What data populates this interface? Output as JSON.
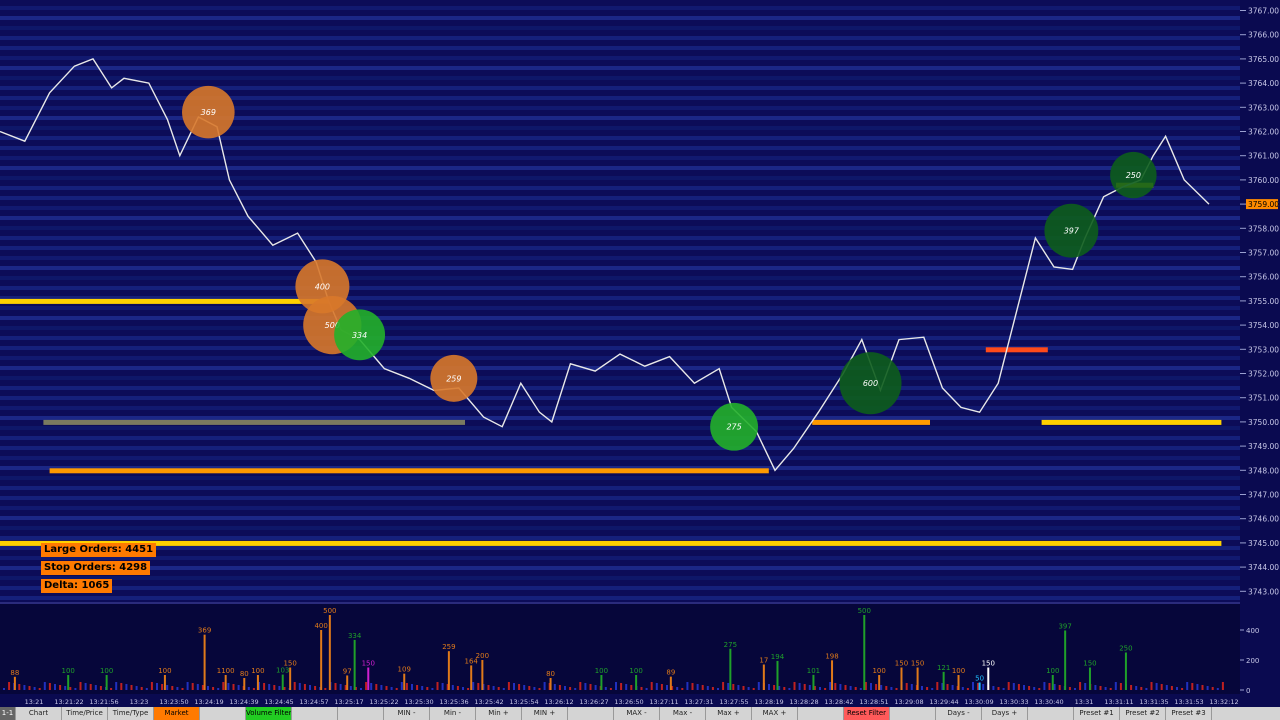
{
  "price_axis": {
    "labels": [
      "3767.00",
      "3766.00",
      "3765.00",
      "3764.00",
      "3763.00",
      "3762.00",
      "3761.00",
      "3760.00",
      "3759.00",
      "3758.00",
      "3757.00",
      "3756.00",
      "3755.00",
      "3754.00",
      "3753.00",
      "3752.00",
      "3751.00",
      "3750.00",
      "3749.00",
      "3748.00",
      "3747.00",
      "3746.00",
      "3745.00",
      "3744.00",
      "3743.00"
    ],
    "current_price": "3759.00"
  },
  "time_axis": {
    "labels": [
      "13:21",
      "13:21:22",
      "13:21:56",
      "13:23",
      "13:23:50",
      "13:24:19",
      "13:24:39",
      "13:24:45",
      "13:24:57",
      "13:25:17",
      "13:25:22",
      "13:25:30",
      "13:25:36",
      "13:25:42",
      "13:25:54",
      "13:26:12",
      "13:26:27",
      "13:26:50",
      "13:27:11",
      "13:27:31",
      "13:27:55",
      "13:28:19",
      "13:28:28",
      "13:28:42",
      "13:28:51",
      "13:29:08",
      "13:29:44",
      "13:30:09",
      "13:30:33",
      "13:30:40",
      "13:31",
      "13:31:11",
      "13:31:35",
      "13:31:53",
      "13:32:12"
    ]
  },
  "info": {
    "large_orders": "Large Orders: 4451",
    "stop_orders": "Stop Orders: 4298",
    "delta": "Delta: 1065"
  },
  "bubbles": [
    {
      "label": "369",
      "price": 3762.8,
      "t": 0.168,
      "color": "orange",
      "size": 369
    },
    {
      "label": "400",
      "price": 3755.6,
      "t": 0.26,
      "color": "orange",
      "size": 400
    },
    {
      "label": "500",
      "price": 3754.0,
      "t": 0.268,
      "color": "orange",
      "size": 500
    },
    {
      "label": "334",
      "price": 3753.6,
      "t": 0.29,
      "color": "green",
      "size": 334
    },
    {
      "label": "259",
      "price": 3751.8,
      "t": 0.366,
      "color": "orange",
      "size": 259
    },
    {
      "label": "275",
      "price": 3749.8,
      "t": 0.592,
      "color": "green",
      "size": 275
    },
    {
      "label": "600",
      "price": 3751.6,
      "t": 0.702,
      "color": "darkgreen",
      "size": 600
    },
    {
      "label": "397",
      "price": 3757.9,
      "t": 0.864,
      "color": "darkgreen",
      "size": 397
    },
    {
      "label": "250",
      "price": 3760.2,
      "t": 0.914,
      "color": "darkgreen",
      "size": 250
    }
  ],
  "liquidity_levels": [
    {
      "price": 3755.0,
      "from": 0.0,
      "to": 0.265,
      "intensity": "yellow"
    },
    {
      "price": 3750.0,
      "from": 0.035,
      "to": 0.375,
      "intensity": "faint"
    },
    {
      "price": 3748.0,
      "from": 0.04,
      "to": 0.62,
      "intensity": "orange"
    },
    {
      "price": 3745.0,
      "from": 0.0,
      "to": 0.985,
      "intensity": "yellow"
    },
    {
      "price": 3750.0,
      "from": 0.84,
      "to": 0.985,
      "intensity": "yellow"
    },
    {
      "price": 3750.0,
      "from": 0.655,
      "to": 0.75,
      "intensity": "orange"
    },
    {
      "price": 3753.0,
      "from": 0.795,
      "to": 0.845,
      "intensity": "red"
    },
    {
      "price": 3759.8,
      "from": 0.9,
      "to": 0.93,
      "intensity": "yellow"
    }
  ],
  "volume_axis": [
    "400",
    "200",
    "0"
  ],
  "volume_labels": [
    {
      "label": "88",
      "t": 0.012,
      "v": 88,
      "color": "orange"
    },
    {
      "label": "100",
      "t": 0.055,
      "v": 100,
      "color": "green"
    },
    {
      "label": "100",
      "t": 0.086,
      "v": 100,
      "color": "green"
    },
    {
      "label": "100",
      "t": 0.133,
      "v": 100,
      "color": "orange"
    },
    {
      "label": "369",
      "t": 0.165,
      "v": 369,
      "color": "orange"
    },
    {
      "label": "1100",
      "t": 0.182,
      "v": 100,
      "color": "orange"
    },
    {
      "label": "80",
      "t": 0.197,
      "v": 80,
      "color": "orange"
    },
    {
      "label": "100",
      "t": 0.208,
      "v": 100,
      "color": "orange"
    },
    {
      "label": "103",
      "t": 0.228,
      "v": 103,
      "color": "green"
    },
    {
      "label": "150",
      "t": 0.234,
      "v": 150,
      "color": "orange"
    },
    {
      "label": "400",
      "t": 0.259,
      "v": 400,
      "color": "orange"
    },
    {
      "label": "500",
      "t": 0.266,
      "v": 500,
      "color": "orange"
    },
    {
      "label": "334",
      "t": 0.286,
      "v": 334,
      "color": "green"
    },
    {
      "label": "97",
      "t": 0.28,
      "v": 97,
      "color": "orange"
    },
    {
      "label": "150",
      "t": 0.297,
      "v": 150,
      "color": "magenta"
    },
    {
      "label": "109",
      "t": 0.326,
      "v": 109,
      "color": "orange"
    },
    {
      "label": "259",
      "t": 0.362,
      "v": 259,
      "color": "orange"
    },
    {
      "label": "164",
      "t": 0.38,
      "v": 164,
      "color": "orange"
    },
    {
      "label": "200",
      "t": 0.389,
      "v": 200,
      "color": "orange"
    },
    {
      "label": "80",
      "t": 0.444,
      "v": 80,
      "color": "orange"
    },
    {
      "label": "100",
      "t": 0.485,
      "v": 100,
      "color": "green"
    },
    {
      "label": "100",
      "t": 0.513,
      "v": 100,
      "color": "green"
    },
    {
      "label": "89",
      "t": 0.541,
      "v": 89,
      "color": "orange"
    },
    {
      "label": "275",
      "t": 0.589,
      "v": 275,
      "color": "green"
    },
    {
      "label": "17",
      "t": 0.616,
      "v": 170,
      "color": "orange"
    },
    {
      "label": "194",
      "t": 0.627,
      "v": 194,
      "color": "green"
    },
    {
      "label": "101",
      "t": 0.656,
      "v": 101,
      "color": "green"
    },
    {
      "label": "198",
      "t": 0.671,
      "v": 198,
      "color": "orange"
    },
    {
      "label": "500",
      "t": 0.697,
      "v": 500,
      "color": "green"
    },
    {
      "label": "100",
      "t": 0.709,
      "v": 100,
      "color": "orange"
    },
    {
      "label": "150",
      "t": 0.727,
      "v": 150,
      "color": "orange"
    },
    {
      "label": "150",
      "t": 0.74,
      "v": 150,
      "color": "orange"
    },
    {
      "label": "121",
      "t": 0.761,
      "v": 121,
      "color": "green"
    },
    {
      "label": "100",
      "t": 0.773,
      "v": 100,
      "color": "orange"
    },
    {
      "label": "150",
      "t": 0.797,
      "v": 150,
      "color": "white"
    },
    {
      "label": "50",
      "t": 0.79,
      "v": 50,
      "color": "cyan"
    },
    {
      "label": "100",
      "t": 0.849,
      "v": 100,
      "color": "green"
    },
    {
      "label": "397",
      "t": 0.859,
      "v": 397,
      "color": "green"
    },
    {
      "label": "150",
      "t": 0.879,
      "v": 150,
      "color": "green"
    },
    {
      "label": "250",
      "t": 0.908,
      "v": 250,
      "color": "green"
    }
  ],
  "toolbar": [
    {
      "label": "1-1",
      "width": 16,
      "style": "dark"
    },
    {
      "label": "Chart",
      "width": 46,
      "style": "normal"
    },
    {
      "label": "Time/Price",
      "width": 46,
      "style": "normal"
    },
    {
      "label": "Time/Type",
      "width": 46,
      "style": "normal"
    },
    {
      "label": "Market",
      "width": 46,
      "style": "orange"
    },
    {
      "label": "",
      "width": 46,
      "style": "normal"
    },
    {
      "label": "Volume Filter",
      "width": 46,
      "style": "green"
    },
    {
      "label": "",
      "width": 46,
      "style": "normal"
    },
    {
      "label": "",
      "width": 46,
      "style": "normal"
    },
    {
      "label": "MIN -",
      "width": 46,
      "style": "normal"
    },
    {
      "label": "Min -",
      "width": 46,
      "style": "normal"
    },
    {
      "label": "Min +",
      "width": 46,
      "style": "normal"
    },
    {
      "label": "MIN +",
      "width": 46,
      "style": "normal"
    },
    {
      "label": "",
      "width": 46,
      "style": "normal"
    },
    {
      "label": "MAX -",
      "width": 46,
      "style": "normal"
    },
    {
      "label": "Max -",
      "width": 46,
      "style": "normal"
    },
    {
      "label": "Max +",
      "width": 46,
      "style": "normal"
    },
    {
      "label": "MAX +",
      "width": 46,
      "style": "normal"
    },
    {
      "label": "",
      "width": 46,
      "style": "normal"
    },
    {
      "label": "Reset Filter",
      "width": 46,
      "style": "red"
    },
    {
      "label": "",
      "width": 46,
      "style": "normal"
    },
    {
      "label": "Days -",
      "width": 46,
      "style": "normal"
    },
    {
      "label": "Days +",
      "width": 46,
      "style": "normal"
    },
    {
      "label": "",
      "width": 46,
      "style": "normal"
    },
    {
      "label": "Preset #1",
      "width": 46,
      "style": "normal"
    },
    {
      "label": "Preset #2",
      "width": 46,
      "style": "normal"
    },
    {
      "label": "Preset #3",
      "width": 46,
      "style": "normal"
    }
  ],
  "colors": {
    "background": "#0c0c58",
    "heat_low": "#1a2a8a",
    "heat_mid": "#2a3aa8",
    "orange": "#e07a1a",
    "green": "#1fb02a",
    "darkgreen": "#0d5a1a",
    "yellow": "#ffdd00"
  }
}
